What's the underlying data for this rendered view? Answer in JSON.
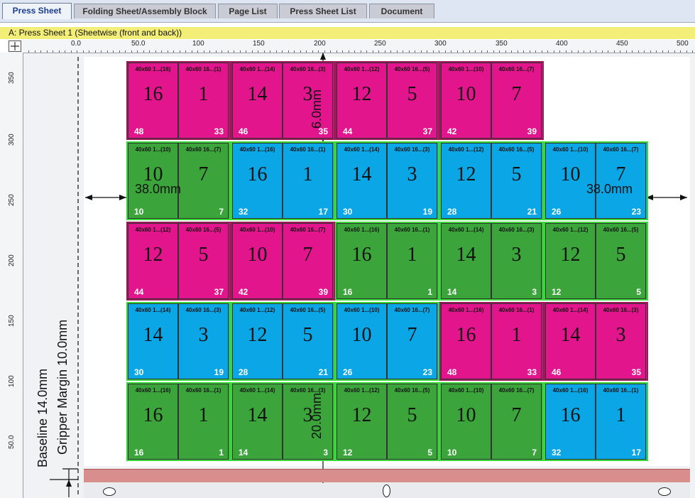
{
  "tabs": [
    {
      "label": "Press Sheet",
      "active": true
    },
    {
      "label": "Folding Sheet/Assembly Block",
      "active": false
    },
    {
      "label": "Page List",
      "active": false
    },
    {
      "label": "Press Sheet List",
      "active": false
    },
    {
      "label": "Document",
      "active": false
    }
  ],
  "title": "A:  Press Sheet 1 (Sheetwise (front and back))",
  "hruler_labels": [
    "0.0",
    "50.0",
    "100",
    "150",
    "200",
    "250",
    "300",
    "350",
    "400",
    "450",
    "500"
  ],
  "vruler_labels": [
    "350",
    "300",
    "250",
    "200",
    "150",
    "100",
    "50.0"
  ],
  "colors": {
    "magenta": "#e2158c",
    "green": "#3ba53b",
    "blue": "#0aa6e6",
    "plate_green": "#39d839"
  },
  "plates": [
    {
      "color": "magenta",
      "pages": [
        {
          "num": "16",
          "fold": "48",
          "label": "40x60 1...(16)"
        },
        {
          "num": "1",
          "fold": "33",
          "label": "40x60 16...(1)"
        }
      ]
    },
    {
      "color": "magenta",
      "pages": [
        {
          "num": "14",
          "fold": "46",
          "label": "40x60 1...(14)"
        },
        {
          "num": "3",
          "fold": "35",
          "label": "40x60 16...(3)"
        }
      ]
    },
    {
      "color": "magenta",
      "pages": [
        {
          "num": "12",
          "fold": "44",
          "label": "40x60 1...(12)"
        },
        {
          "num": "5",
          "fold": "37",
          "label": "40x60 16...(5)"
        }
      ]
    },
    {
      "color": "magenta",
      "pages": [
        {
          "num": "10",
          "fold": "42",
          "label": "40x60 1...(10)"
        },
        {
          "num": "7",
          "fold": "39",
          "label": "40x60 16...(7)"
        }
      ]
    },
    {
      "color": "green",
      "pages": [
        {
          "num": "10",
          "fold": "10",
          "label": "40x60 1...(10)"
        },
        {
          "num": "7",
          "fold": "7",
          "label": "40x60 16...(7)"
        }
      ]
    },
    {
      "color": "blue",
      "pages": [
        {
          "num": "16",
          "fold": "32",
          "label": "40x60 1...(16)"
        },
        {
          "num": "1",
          "fold": "17",
          "label": "40x60 16...(1)"
        }
      ]
    },
    {
      "color": "blue",
      "pages": [
        {
          "num": "14",
          "fold": "30",
          "label": "40x60 1...(14)"
        },
        {
          "num": "3",
          "fold": "19",
          "label": "40x60 16...(3)"
        }
      ]
    },
    {
      "color": "blue",
      "pages": [
        {
          "num": "12",
          "fold": "28",
          "label": "40x60 1...(12)"
        },
        {
          "num": "5",
          "fold": "21",
          "label": "40x60 16...(5)"
        }
      ]
    },
    {
      "color": "blue",
      "pages": [
        {
          "num": "10",
          "fold": "26",
          "label": "40x60 1...(10)"
        },
        {
          "num": "7",
          "fold": "23",
          "label": "40x60 16...(7)"
        }
      ]
    },
    {
      "color": "magenta",
      "pages": [
        {
          "num": "12",
          "fold": "44",
          "label": "40x60 1...(12)"
        },
        {
          "num": "5",
          "fold": "37",
          "label": "40x60 16...(5)"
        }
      ]
    },
    {
      "color": "magenta",
      "pages": [
        {
          "num": "10",
          "fold": "42",
          "label": "40x60 1...(10)"
        },
        {
          "num": "7",
          "fold": "39",
          "label": "40x60 16...(7)"
        }
      ]
    },
    {
      "color": "green",
      "pages": [
        {
          "num": "16",
          "fold": "16",
          "label": "40x60 1...(16)"
        },
        {
          "num": "1",
          "fold": "1",
          "label": "40x60 16...(1)"
        }
      ]
    },
    {
      "color": "green",
      "pages": [
        {
          "num": "14",
          "fold": "14",
          "label": "40x60 1...(14)"
        },
        {
          "num": "3",
          "fold": "3",
          "label": "40x60 16...(3)"
        }
      ]
    },
    {
      "color": "green",
      "pages": [
        {
          "num": "12",
          "fold": "12",
          "label": "40x60 1...(12)"
        },
        {
          "num": "5",
          "fold": "5",
          "label": "40x60 16...(5)"
        }
      ]
    },
    {
      "color": "blue",
      "pages": [
        {
          "num": "14",
          "fold": "30",
          "label": "40x60 1...(14)"
        },
        {
          "num": "3",
          "fold": "19",
          "label": "40x60 16...(3)"
        }
      ]
    },
    {
      "color": "blue",
      "pages": [
        {
          "num": "12",
          "fold": "28",
          "label": "40x60 1...(12)"
        },
        {
          "num": "5",
          "fold": "21",
          "label": "40x60 16...(5)"
        }
      ]
    },
    {
      "color": "blue",
      "pages": [
        {
          "num": "10",
          "fold": "26",
          "label": "40x60 1...(10)"
        },
        {
          "num": "7",
          "fold": "23",
          "label": "40x60 16...(7)"
        }
      ]
    },
    {
      "color": "magenta",
      "pages": [
        {
          "num": "16",
          "fold": "48",
          "label": "40x60 1...(16)"
        },
        {
          "num": "1",
          "fold": "33",
          "label": "40x60 16...(1)"
        }
      ]
    },
    {
      "color": "magenta",
      "pages": [
        {
          "num": "14",
          "fold": "46",
          "label": "40x60 1...(14)"
        },
        {
          "num": "3",
          "fold": "35",
          "label": "40x60 16...(3)"
        }
      ]
    },
    {
      "color": "green",
      "pages": [
        {
          "num": "16",
          "fold": "16",
          "label": "40x60 1...(16)"
        },
        {
          "num": "1",
          "fold": "1",
          "label": "40x60 16...(1)"
        }
      ]
    },
    {
      "color": "green",
      "pages": [
        {
          "num": "14",
          "fold": "14",
          "label": "40x60 1...(14)"
        },
        {
          "num": "3",
          "fold": "3",
          "label": "40x60 16...(3)"
        }
      ]
    },
    {
      "color": "green",
      "pages": [
        {
          "num": "12",
          "fold": "12",
          "label": "40x60 1...(12)"
        },
        {
          "num": "5",
          "fold": "5",
          "label": "40x60 16...(5)"
        }
      ]
    },
    {
      "color": "green",
      "pages": [
        {
          "num": "10",
          "fold": "10",
          "label": "40x60 1...(10)"
        },
        {
          "num": "7",
          "fold": "7",
          "label": "40x60 16...(7)"
        }
      ]
    },
    {
      "color": "blue",
      "pages": [
        {
          "num": "16",
          "fold": "32",
          "label": "40x60 1...(16)"
        },
        {
          "num": "1",
          "fold": "17",
          "label": "40x60 16...(1)"
        }
      ]
    }
  ],
  "dimensions": {
    "left_margin": "38.0mm",
    "right_margin": "38.0mm",
    "top_gap": "6.0mm",
    "bottom_gap": "20.0mm",
    "baseline": "Baseline 14.0mm",
    "gripper": "Gripper Margin 10.0mm"
  }
}
